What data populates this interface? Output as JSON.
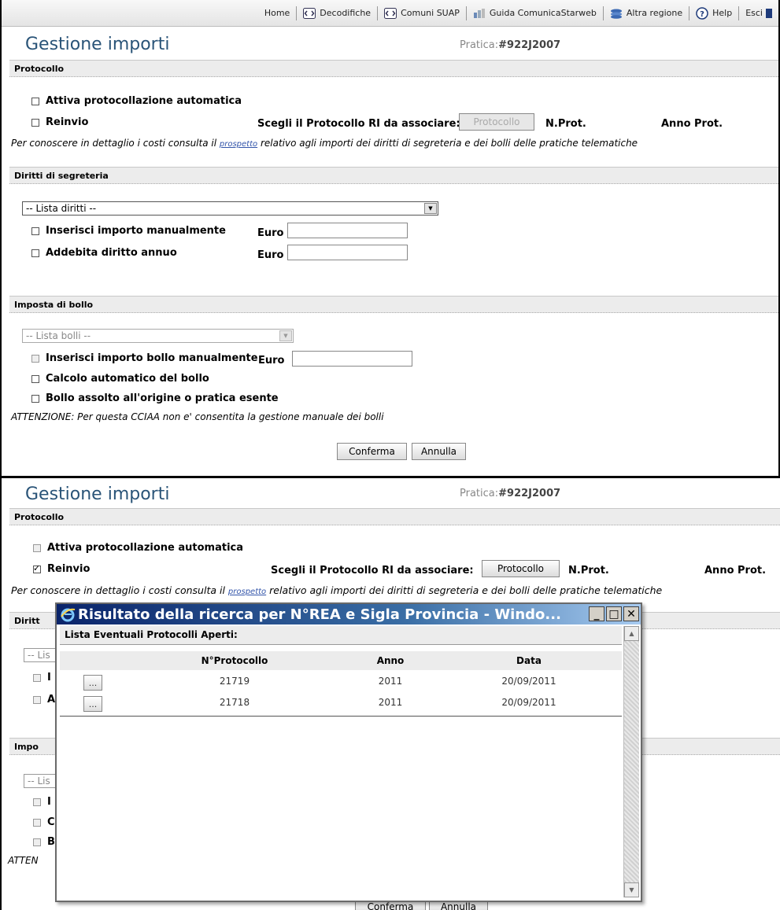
{
  "nav": {
    "items": [
      {
        "label": "Home",
        "icon": ""
      },
      {
        "label": "Decodifiche",
        "icon": "code-icon"
      },
      {
        "label": "Comuni SUAP",
        "icon": "code-icon"
      },
      {
        "label": "Guida ComunicaStarweb",
        "icon": "guide-icon"
      },
      {
        "label": "Altra regione",
        "icon": "region-icon"
      },
      {
        "label": "Help",
        "icon": "help-icon"
      },
      {
        "label": "Esci",
        "icon": "exit-icon"
      }
    ]
  },
  "top": {
    "title": "Gestione importi",
    "pratica_label": "Pratica:",
    "pratica_value": "#922J2007",
    "protocollo": {
      "section": "Protocollo",
      "attiva": "Attiva protocollazione automatica",
      "reinvio": "Reinvio",
      "scegli": "Scegli il Protocollo RI da associare:",
      "btn": "Protocollo",
      "nprot": "N.Prot.",
      "annoprot": "Anno Prot.",
      "note_pre": "Per conoscere in dettaglio i costi consulta il",
      "note_link": "prospetto",
      "note_post": "relativo agli importi dei diritti di segreteria e dei bolli delle pratiche telematiche"
    },
    "diritti": {
      "section": "Diritti di segreteria",
      "select": "-- Lista diritti --",
      "inserisci": "Inserisci importo manualmente",
      "addebita": "Addebita diritto annuo",
      "euro": "Euro"
    },
    "bollo": {
      "section": "Imposta di bollo",
      "select": "-- Lista bolli --",
      "inserisci": "Inserisci importo bollo manualmente",
      "euro": "Euro",
      "calcolo": "Calcolo automatico del bollo",
      "assolto": "Bollo assolto all'origine o pratica esente",
      "attenzione": "ATTENZIONE: Per questa CCIAA non e' consentita la gestione manuale dei bolli"
    },
    "conferma": "Conferma",
    "annulla": "Annulla"
  },
  "bottom": {
    "title": "Gestione importi",
    "pratica_label": "Pratica:",
    "pratica_value": "#922J2007",
    "section_protocollo": "Protocollo",
    "attiva": "Attiva protocollazione automatica",
    "reinvio": "Reinvio",
    "scegli": "Scegli il Protocollo RI da associare:",
    "btn": "Protocollo",
    "nprot": "N.Prot.",
    "annoprot": "Anno Prot.",
    "note_pre": "Per conoscere in dettaglio i costi consulta il",
    "note_link": "prospetto",
    "note_post": "relativo agli importi dei diritti di segreteria e dei bolli delle pratiche telematiche",
    "cut_diritti": "Diritt",
    "cut_lista1": "-- Lis",
    "cut_i": "I",
    "cut_a": "A",
    "cut_impo": "Impo",
    "cut_lista2": "-- Lis",
    "cut_i2": "I",
    "cut_c": "C",
    "cut_b": "B",
    "cut_atten": "ATTEN",
    "cut_conferma": "Conferma",
    "cut_annulla": "Annulla"
  },
  "popup": {
    "title": "Risultato della ricerca per N°REA e Sigla Provincia - Windo...",
    "header": "Lista Eventuali Protocolli Aperti:",
    "columns": [
      "N°Protocollo",
      "Anno",
      "Data"
    ],
    "rows": [
      {
        "protocollo": "21719",
        "anno": "2011",
        "data": "20/09/2011"
      },
      {
        "protocollo": "21718",
        "anno": "2011",
        "data": "20/09/2011"
      }
    ],
    "row_button": "..."
  }
}
